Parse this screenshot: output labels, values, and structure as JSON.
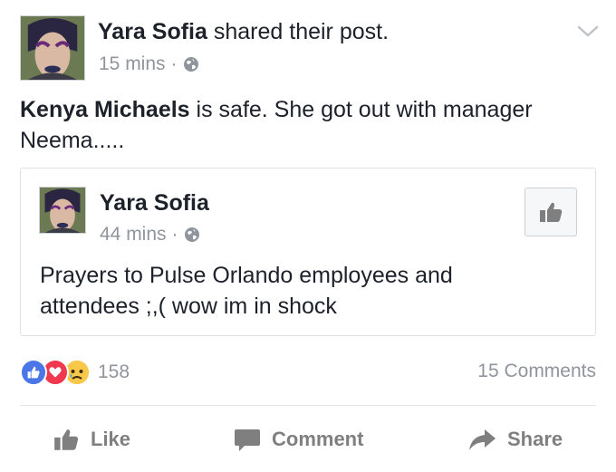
{
  "post": {
    "author": "Yara Sofia",
    "action_text": "shared their post.",
    "time": "15 mins",
    "separator": "·",
    "text_bold": "Kenya Michaels",
    "text_rest": " is safe. She got out with manager Neema....."
  },
  "shared": {
    "author": "Yara Sofia",
    "time": "44 mins",
    "separator": "·",
    "text": "Prayers to Pulse Orlando employees and attendees ;,( wow im in shock"
  },
  "reactions": {
    "count": "158",
    "comments": "15 Comments",
    "icons": [
      "like-reaction-icon",
      "love-reaction-icon",
      "sad-reaction-icon"
    ]
  },
  "actions": {
    "like": "Like",
    "comment": "Comment",
    "share": "Share"
  },
  "colors": {
    "name": "#1d2129",
    "meta": "#90949c",
    "like_blue": "#4a76e8",
    "love_red": "#f0394f",
    "action_gray": "#7f7f7f"
  }
}
